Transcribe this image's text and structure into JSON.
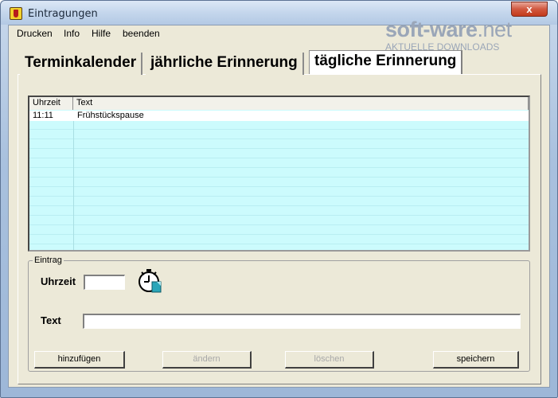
{
  "window": {
    "title": "Eintragungen",
    "close_label": "x"
  },
  "menu": {
    "items": [
      "Drucken",
      "Info",
      "Hilfe",
      "beenden"
    ]
  },
  "watermark": {
    "brand": "soft-ware",
    "tld": ".net",
    "tagline": "AKTUELLE DOWNLOADS"
  },
  "tabs": [
    {
      "label": "Terminkalender",
      "active": false
    },
    {
      "label": "jährliche Erinnerung",
      "active": false
    },
    {
      "label": "tägliche Erinnerung",
      "active": true
    }
  ],
  "list": {
    "columns": [
      "Uhrzeit",
      "Text"
    ],
    "rows": [
      {
        "time": "11:11",
        "text": "Frühstückspause"
      }
    ]
  },
  "entry": {
    "group_label": "Eintrag",
    "time_label": "Uhrzeit",
    "time_value": "",
    "text_label": "Text",
    "text_value": ""
  },
  "buttons": {
    "add": "hinzufügen",
    "edit": "ändern",
    "delete": "löschen",
    "save": "speichern"
  },
  "colors": {
    "list_background": "#ccfbfd",
    "watermark": "#9aa6b8"
  }
}
